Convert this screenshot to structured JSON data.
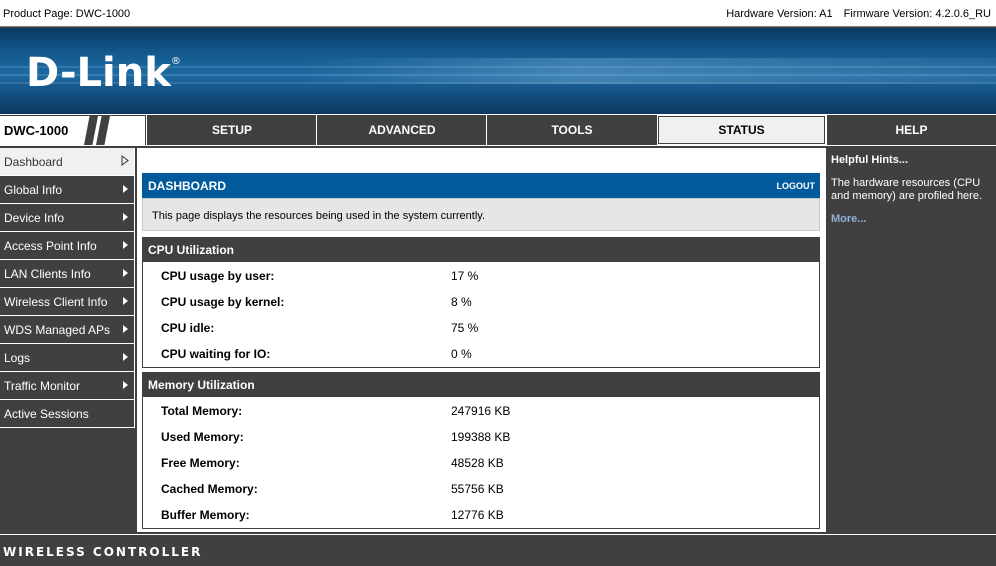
{
  "topbar": {
    "product_page": "Product Page: DWC-1000",
    "hardware_version": "Hardware Version: A1",
    "firmware_version": "Firmware Version: 4.2.0.6_RU"
  },
  "banner": {
    "logo_text": "D-Link",
    "logo_mark": "®"
  },
  "nav": {
    "model": "DWC-1000",
    "tabs": [
      {
        "label": "SETUP",
        "active": false
      },
      {
        "label": "ADVANCED",
        "active": false
      },
      {
        "label": "TOOLS",
        "active": false
      },
      {
        "label": "STATUS",
        "active": true
      },
      {
        "label": "HELP",
        "active": false
      }
    ]
  },
  "sidebar": {
    "items": [
      {
        "label": "Dashboard",
        "active": true
      },
      {
        "label": "Global Info"
      },
      {
        "label": "Device Info"
      },
      {
        "label": "Access Point Info"
      },
      {
        "label": "LAN Clients Info"
      },
      {
        "label": "Wireless Client Info"
      },
      {
        "label": "WDS Managed APs"
      },
      {
        "label": "Logs"
      },
      {
        "label": "Traffic Monitor"
      },
      {
        "label": "Active Sessions"
      }
    ]
  },
  "dashboard": {
    "title": "DASHBOARD",
    "logout": "LOGOUT",
    "description": "This page displays the resources being used in the system currently."
  },
  "cpu": {
    "title": "CPU Utilization",
    "rows": [
      {
        "label": "CPU usage by user:",
        "value": "17 %"
      },
      {
        "label": "CPU usage by kernel:",
        "value": "8 %"
      },
      {
        "label": "CPU idle:",
        "value": "75 %"
      },
      {
        "label": "CPU waiting for IO:",
        "value": "0 %"
      }
    ]
  },
  "memory": {
    "title": "Memory Utilization",
    "rows": [
      {
        "label": "Total Memory:",
        "value": "247916 KB"
      },
      {
        "label": "Used Memory:",
        "value": "199388 KB"
      },
      {
        "label": "Free Memory:",
        "value": "48528 KB"
      },
      {
        "label": "Cached Memory:",
        "value": "55756 KB"
      },
      {
        "label": "Buffer Memory:",
        "value": "12776 KB"
      }
    ]
  },
  "hints": {
    "title": "Helpful Hints...",
    "text": "The hardware resources (CPU and memory) are profiled here.",
    "more": "More..."
  },
  "footer": {
    "text": "WIRELESS CONTROLLER"
  },
  "colors": {
    "accent_blue": "#005a9c",
    "dark": "#404040",
    "link": "#8fb2d6"
  }
}
